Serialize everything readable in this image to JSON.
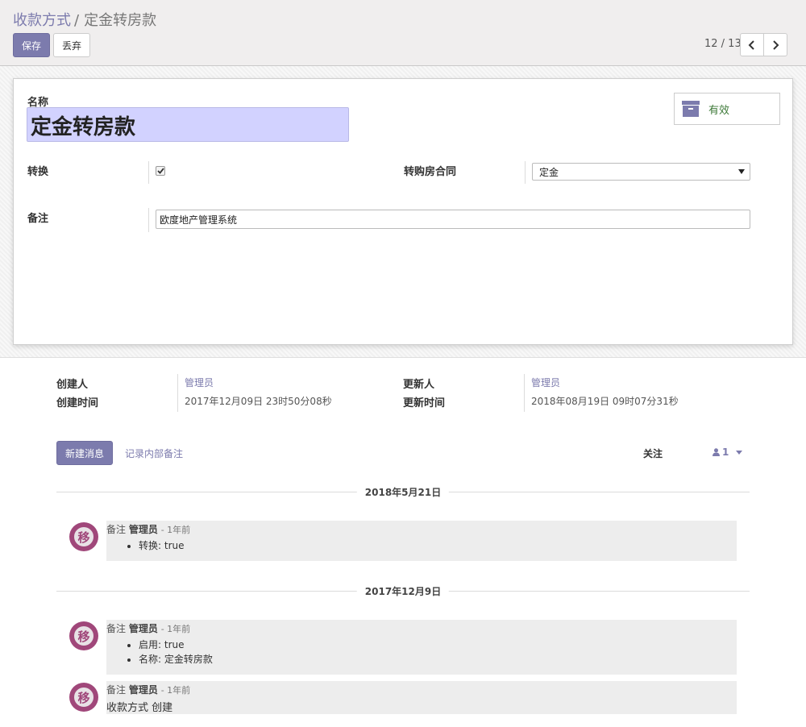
{
  "breadcrumb": {
    "parent": "收款方式",
    "separator": "/",
    "current": "定金转房款"
  },
  "buttons": {
    "save": "保存",
    "discard": "丢弃"
  },
  "pager": {
    "value": "12 / 13"
  },
  "form": {
    "name_label": "名称",
    "name_value": "定金转房款",
    "active_label": "有效",
    "convert_label": "转换",
    "convert_checked": true,
    "contract_label": "转购房合同",
    "contract_value": "定金",
    "note_label": "备注",
    "note_value": "欧度地产管理系统"
  },
  "meta": {
    "created_by_label": "创建人",
    "created_by": "管理员",
    "created_on_label": "创建时间",
    "created_on": "2017年12月09日 23时50分08秒",
    "updated_by_label": "更新人",
    "updated_by": "管理员",
    "updated_on_label": "更新时间",
    "updated_on": "2018年08月19日 09时07分31秒"
  },
  "chatter": {
    "new_message": "新建消息",
    "log_note": "记录内部备注",
    "follow": "关注",
    "followers_count": "1",
    "dates": [
      "2018年5月21日",
      "2017年12月9日"
    ],
    "avatar_char": "移",
    "messages": [
      {
        "type": "备注",
        "author": "管理员",
        "ago": "- 1年前",
        "items": [
          "转换: true"
        ]
      },
      {
        "type": "备注",
        "author": "管理员",
        "ago": "- 1年前",
        "items": [
          "启用: true",
          "名称: 定金转房款"
        ]
      },
      {
        "type": "备注",
        "author": "管理员",
        "ago": "- 1年前",
        "body": "收款方式 创建"
      }
    ]
  },
  "colors": {
    "primary": "#7c7bad",
    "active_text": "#3e7a39",
    "avatar": "#a0477a",
    "title_bg": "#d2d2ff"
  }
}
